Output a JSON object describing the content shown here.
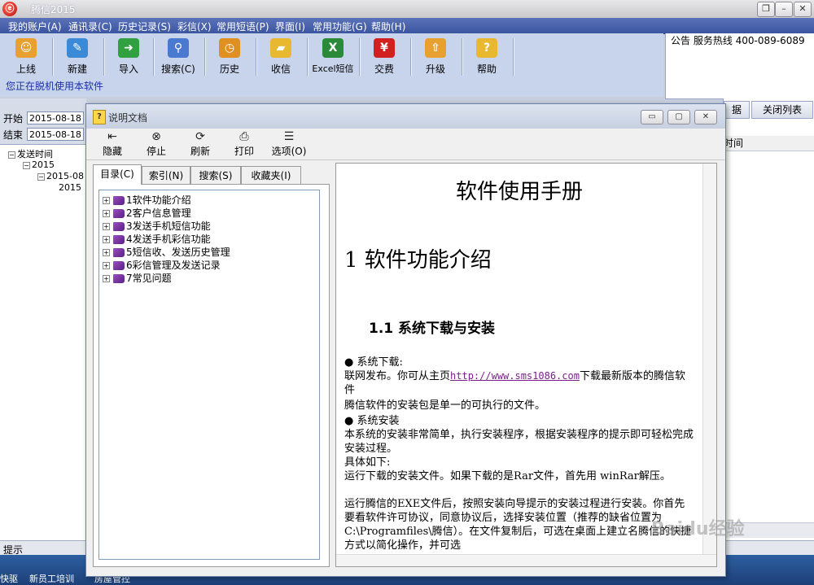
{
  "app": {
    "title": "腾信2015",
    "logo_glyph": "ⓔ"
  },
  "window_controls": {
    "restore": "❐",
    "minimize": "–",
    "close": "✕"
  },
  "menu": [
    "我的账户(A)",
    "通讯录(C)",
    "历史记录(S)",
    "彩信(X)",
    "常用短语(P)",
    "界面(I)",
    "常用功能(G)",
    "帮助(H)"
  ],
  "toolbar": {
    "buttons": [
      {
        "label": "上线",
        "icon": "person-icon",
        "glyph": "☺",
        "color": "#e8a030"
      },
      {
        "label": "新建",
        "icon": "pencil-icon",
        "glyph": "✎",
        "color": "#3a8ad8"
      },
      {
        "label": "导入",
        "icon": "import-arrow-icon",
        "glyph": "➜",
        "color": "#30a040"
      },
      {
        "label": "搜索(C)",
        "icon": "magnifier-icon",
        "glyph": "⚲",
        "color": "#4a7ad0"
      },
      {
        "label": "历史",
        "icon": "clock-icon",
        "glyph": "◷",
        "color": "#e09020"
      },
      {
        "label": "收信",
        "icon": "folder-icon",
        "glyph": "▰",
        "color": "#e8b830"
      },
      {
        "label": "Excel短信",
        "icon": "excel-icon",
        "glyph": "X",
        "color": "#2a8a3a"
      },
      {
        "label": "交费",
        "icon": "yen-icon",
        "glyph": "¥",
        "color": "#d02020"
      },
      {
        "label": "升级",
        "icon": "upgrade-arrow-icon",
        "glyph": "⇧",
        "color": "#e8a030"
      },
      {
        "label": "帮助",
        "icon": "help-folder-icon",
        "glyph": "?",
        "color": "#e8b830"
      }
    ],
    "offline_notice": "您正在脱机使用本软件"
  },
  "notice": {
    "text": "公告 服务热线 400-089-6089"
  },
  "left_pane": {
    "start_label": "开始",
    "start_date": "2015-08-18",
    "end_label": "结束",
    "end_date": "2015-08-18",
    "tree": {
      "root": "发送时间",
      "year": "2015",
      "month": "2015-08",
      "day": "2015"
    }
  },
  "right_pane": {
    "tab1": "据",
    "tab2": "关闭列表",
    "header": "时间"
  },
  "status": {
    "text": "提示"
  },
  "taskbar": {
    "item1": "快驱",
    "item2": "新员工培训",
    "item3": "房屋管控"
  },
  "help_dialog": {
    "title": "说明文档",
    "controls": {
      "minimize": "▭",
      "maximize": "▢",
      "close": "✕"
    },
    "toolbar": [
      {
        "label": "隐藏",
        "icon": "hide-icon",
        "glyph": "⇤"
      },
      {
        "label": "停止",
        "icon": "stop-icon",
        "glyph": "⊗"
      },
      {
        "label": "刷新",
        "icon": "refresh-icon",
        "glyph": "⟳"
      },
      {
        "label": "打印",
        "icon": "printer-icon",
        "glyph": "⎙"
      },
      {
        "label": "选项(O)",
        "icon": "options-icon",
        "glyph": "☰"
      }
    ],
    "tabs": [
      "目录(C)",
      "索引(N)",
      "搜索(S)",
      "收藏夹(I)"
    ],
    "toc": [
      "1软件功能介绍",
      "2客户信息管理",
      "3发送手机短信功能",
      "4发送手机彩信功能",
      "5短信收、发送历史管理",
      "6彩信管理及发送记录",
      "7常见问题"
    ],
    "doc": {
      "h1": "软件使用手册",
      "h2": "1 软件功能介绍",
      "h3": "1.1 系统下载与安装",
      "bullet1": "● 系统下载:",
      "p1_before": "联网发布。你可从主页",
      "p1_link": "http://www.sms1086.com",
      "p1_after": "下载最新版本的腾信软件",
      "p2": "腾信软件的安装包是单一的可执行的文件。",
      "bullet2": "● 系统安装",
      "p3": "本系统的安装非常简单，执行安装程序，根据安装程序的提示即可轻松完成安装过程。",
      "p4": "具体如下:",
      "p5": "运行下载的安装文件。如果下载的是Rar文件，首先用 winRar解压。",
      "p6": "运行腾信的EXE文件后，按照安装向导提示的安装过程进行安装。你首先要看软件许可协议，同意协议后，选择安装位置（推荐的缺省位置为C:\\Programfiles\\腾信）。在文件复制后，可选在桌面上建立名腾信的快捷方式以简化操作，并可选"
    }
  },
  "watermark": "Baidu经验"
}
